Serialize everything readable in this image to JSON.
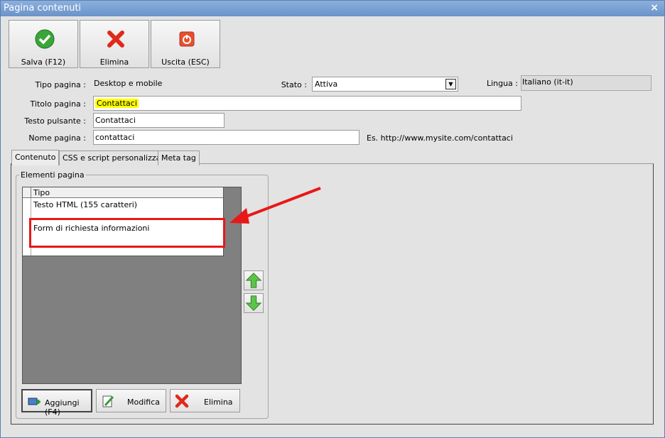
{
  "window": {
    "title": "Pagina contenuti",
    "close_glyph": "×"
  },
  "toolbar": {
    "save_label": "Salva (F12)",
    "delete_label": "Elimina",
    "exit_label": "Uscita (ESC)"
  },
  "form": {
    "tipo_pagina_label": "Tipo pagina :",
    "tipo_pagina_value": "Desktop e mobile",
    "stato_label": "Stato :",
    "stato_value": "Attiva",
    "lingua_label": "Lingua :",
    "lingua_value": "Italiano (it-it)",
    "titolo_label": "Titolo pagina :",
    "titolo_value": "Contattaci",
    "testo_pulsante_label": "Testo pulsante :",
    "testo_pulsante_value": "Contattaci",
    "nome_pagina_label": "Nome pagina :",
    "nome_pagina_value": "contattaci",
    "url_example": "Es. http://www.mysite.com/contattaci"
  },
  "tabs": [
    {
      "label": "Contenuto"
    },
    {
      "label": "CSS e script personalizzati"
    },
    {
      "label": "Meta tag"
    }
  ],
  "elements": {
    "group_title": "Elementi pagina",
    "column_header": "Tipo",
    "rows": [
      "Testo HTML (155 caratteri)",
      "Form di richiesta informazioni"
    ]
  },
  "bottom_buttons": {
    "add_label": "Aggiungi (F4)",
    "edit_label": "Modifica",
    "delete_label": "Elimina"
  },
  "colors": {
    "highlight": "#ffff00",
    "annotation_red": "#e81818",
    "titlebar": "#6a93c9"
  }
}
